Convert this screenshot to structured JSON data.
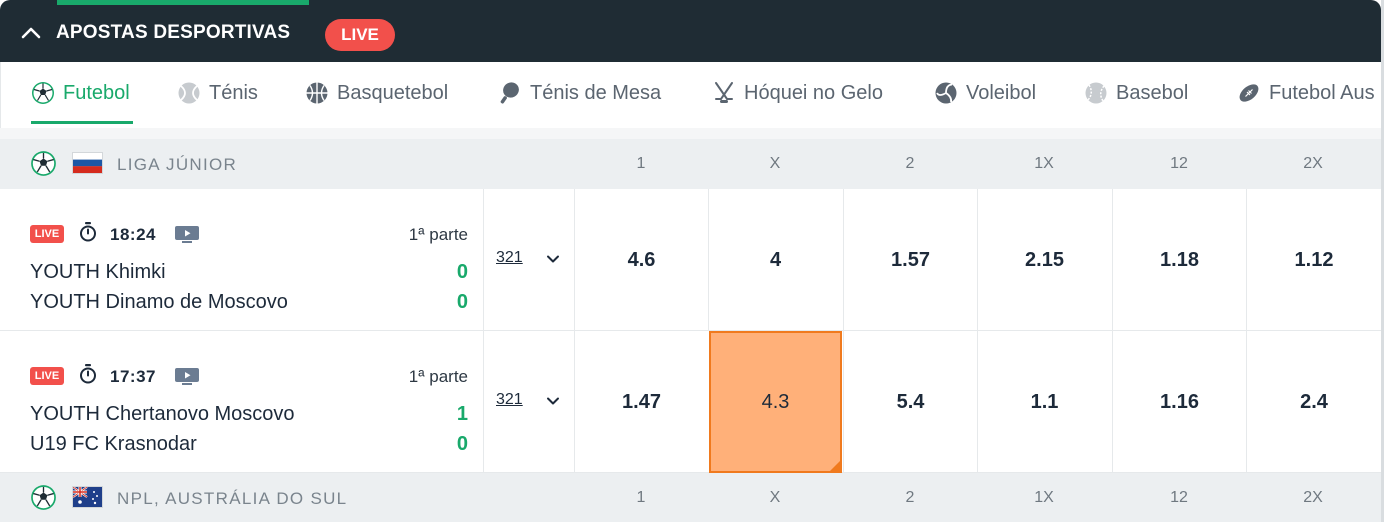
{
  "header": {
    "title": "APOSTAS DESPORTIVAS",
    "live_label": "LIVE"
  },
  "tabs": [
    {
      "label": "Futebol",
      "icon": "soccer-ball-icon",
      "active": true
    },
    {
      "label": "Ténis",
      "icon": "tennis-ball-icon",
      "active": false
    },
    {
      "label": "Basquetebol",
      "icon": "basketball-icon",
      "active": false
    },
    {
      "label": "Ténis de Mesa",
      "icon": "table-tennis-paddle-icon",
      "active": false
    },
    {
      "label": "Hóquei no Gelo",
      "icon": "hockey-sticks-icon",
      "active": false
    },
    {
      "label": "Voleibol",
      "icon": "volleyball-icon",
      "active": false
    },
    {
      "label": "Basebol",
      "icon": "baseball-icon",
      "active": false
    },
    {
      "label": "Futebol Aus",
      "icon": "american-football-icon",
      "active": false
    }
  ],
  "columns": [
    "1",
    "X",
    "2",
    "1X",
    "12",
    "2X"
  ],
  "leagues": [
    {
      "name": "LIGA JÚNIOR",
      "flag": "russia-flag",
      "matches": [
        {
          "live_label": "LIVE",
          "time": "18:24",
          "period": "1ª parte",
          "home": "YOUTH Khimki",
          "away": "YOUTH Dinamo de Moscovo",
          "home_score": "0",
          "away_score": "0",
          "markets": "321",
          "odds": [
            "4.6",
            "4",
            "1.57",
            "2.15",
            "1.18",
            "1.12"
          ]
        },
        {
          "live_label": "LIVE",
          "time": "17:37",
          "period": "1ª parte",
          "home": "YOUTH Chertanovo Moscovo",
          "away": "U19 FC Krasnodar",
          "home_score": "1",
          "away_score": "0",
          "markets": "321",
          "odds": [
            "1.47",
            "4.3",
            "5.4",
            "1.1",
            "1.16",
            "2.4"
          ],
          "selected_odd": "X"
        }
      ]
    },
    {
      "name": "NPL, AUSTRÁLIA DO SUL",
      "flag": "australia-flag",
      "matches": []
    }
  ],
  "colors": {
    "header_bg": "#1f2c34",
    "accent_green": "#19a96b",
    "live_red": "#f2504b",
    "selected_odd_bg": "#ffb079",
    "selected_odd_border": "#f07a1e"
  }
}
